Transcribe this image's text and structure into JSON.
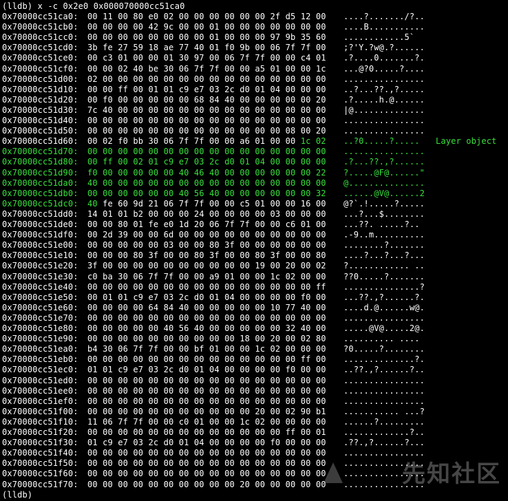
{
  "terminal": {
    "command": "(lldb) x -c 0x2e0 0x000070000cc51ca0",
    "prompt_end": "(lldb)",
    "annotation": "Layer object",
    "highlight_color": "#37e03c",
    "rows": [
      {
        "addr": "0x70000cc51ca0:",
        "hex": "00 11 00 80 e0 02 00 00 00 00 00 00 2f d5 12 00",
        "ascii": "....?......./?..",
        "hl": "none"
      },
      {
        "addr": "0x70000cc51cb0:",
        "hex": "00 00 00 00 42 9c 00 00 01 00 00 00 00 00 00 00",
        "ascii": "....B...........",
        "hl": "none"
      },
      {
        "addr": "0x70000cc51cc0:",
        "hex": "00 00 00 00 00 00 00 00 01 00 00 00 97 9b 35 60",
        "ascii": "............5`",
        "hl": "none"
      },
      {
        "addr": "0x70000cc51cd0:",
        "hex": "3b fe 27 59 18 ae 77 40 01 f0 9b 00 06 7f 7f 00",
        "ascii": ";?'Y.?w@.?......",
        "hl": "none"
      },
      {
        "addr": "0x70000cc51ce0:",
        "hex": "00 c3 01 00 00 01 30 97 00 06 7f 7f 00 00 c4 01",
        "ascii": ".?....0.......?.",
        "hl": "none"
      },
      {
        "addr": "0x70000cc51cf0:",
        "hex": "00 00 02 40 be 30 06 7f 7f 00 00 a5 01 00 00 1c",
        "ascii": "...@?0.....?....",
        "hl": "none"
      },
      {
        "addr": "0x70000cc51d00:",
        "hex": "02 00 00 00 00 00 00 00 00 00 00 00 00 00 00 00",
        "ascii": "................",
        "hl": "none"
      },
      {
        "addr": "0x70000cc51d10:",
        "hex": "00 00 ff 00 01 01 c9 e7 03 2c d0 01 04 00 00 00",
        "ascii": "..?...??.,?.....",
        "hl": "none"
      },
      {
        "addr": "0x70000cc51d20:",
        "hex": "00 f0 00 00 00 00 00 68 84 40 00 00 00 00 00 20",
        "ascii": ".?.....h.@......",
        "hl": "none"
      },
      {
        "addr": "0x70000cc51d30:",
        "hex": "7c 40 00 00 00 00 00 00 00 00 00 00 00 00 00 00",
        "ascii": "|@..............",
        "hl": "none"
      },
      {
        "addr": "0x70000cc51d40:",
        "hex": "00 00 00 00 00 00 00 00 00 00 00 00 00 00 00 00",
        "ascii": "................",
        "hl": "none"
      },
      {
        "addr": "0x70000cc51d50:",
        "hex": "00 00 00 00 00 00 00 00 00 00 00 00 00 08 00 20",
        "ascii": "................",
        "hl": "none"
      },
      {
        "addr": "0x70000cc51d60:",
        "hex": "00 02 f0 bb 30 06 7f 7f 00 00 a6 01 00 00 1c 02",
        "ascii": "..?0.....?.....",
        "hl": "tail2"
      },
      {
        "addr": "0x70000cc51d70:",
        "hex": "00 00 00 00 00 00 00 00 00 00 00 00 00 00 00 00",
        "ascii": "................",
        "hl": "full"
      },
      {
        "addr": "0x70000cc51d80:",
        "hex": "00 ff 00 02 01 c9 e7 03 2c d0 01 04 00 00 00 00",
        "ascii": ".?...??.,?......",
        "hl": "full"
      },
      {
        "addr": "0x70000cc51d90:",
        "hex": "f0 00 00 00 00 00 40 46 40 00 00 00 00 00 00 22",
        "ascii": "?.....@F@......\"",
        "hl": "full"
      },
      {
        "addr": "0x70000cc51da0:",
        "hex": "40 00 00 00 00 00 00 00 00 00 00 00 00 00 00 00",
        "ascii": "@...............",
        "hl": "full"
      },
      {
        "addr": "0x70000cc51db0:",
        "hex": "00 00 00 00 00 00 40 56 40 00 00 00 00 00 00 32",
        "ascii": "......@V@......2",
        "hl": "full"
      },
      {
        "addr": "0x70000cc51dc0:",
        "hex": "40 fe 60 9d 21 06 7f 7f 00 00 c5 01 00 00 16 00",
        "ascii": "@?`.!.....?.....",
        "hl": "first"
      },
      {
        "addr": "0x70000cc51dd0:",
        "hex": "14 01 01 b2 00 00 00 24 00 00 00 00 03 00 00 00",
        "ascii": "...?...$........",
        "hl": "none"
      },
      {
        "addr": "0x70000cc51de0:",
        "hex": "00 00 80 01 fe e0 1d 20 06 7f 7f 00 00 c6 01 00",
        "ascii": "...??. .....?..",
        "hl": "none"
      },
      {
        "addr": "0x70000cc51df0:",
        "hex": "00 2d 39 00 00 6d 00 00 00 00 00 00 00 00 00 00",
        "ascii": ".-9..m..........",
        "hl": "none"
      },
      {
        "addr": "0x70000cc51e00:",
        "hex": "00 00 00 00 00 03 00 00 80 3f 00 00 00 00 00 00",
        "ascii": "........?.......",
        "hl": "none"
      },
      {
        "addr": "0x70000cc51e10:",
        "hex": "00 00 00 80 3f 00 00 80 3f 00 00 80 3f 00 00 80",
        "ascii": "....?...?...?...",
        "hl": "none"
      },
      {
        "addr": "0x70000cc51e20:",
        "hex": "3f 00 00 00 00 00 00 00 00 00 00 19 00 20 00 02",
        "ascii": "?............ ..",
        "hl": "none"
      },
      {
        "addr": "0x70000cc51e30:",
        "hex": "c0 ba 30 06 7f 7f 00 00 a9 01 00 00 1c 02 00 00",
        "ascii": "??0.....?.......",
        "hl": "none"
      },
      {
        "addr": "0x70000cc51e40:",
        "hex": "00 00 00 00 00 00 00 00 00 00 00 00 00 00 00 ff",
        "ascii": "...............?",
        "hl": "none"
      },
      {
        "addr": "0x70000cc51e50:",
        "hex": "00 01 01 c9 e7 03 2c d0 01 04 00 00 00 00 f0 00",
        "ascii": "...??.,?......?.",
        "hl": "none"
      },
      {
        "addr": "0x70000cc51e60:",
        "hex": "00 00 00 00 64 84 40 00 00 00 00 00 10 77 40 00",
        "ascii": "....d.@......w@.",
        "hl": "none"
      },
      {
        "addr": "0x70000cc51e70:",
        "hex": "00 00 00 00 00 00 00 00 00 00 00 00 00 00 00 00",
        "ascii": "................",
        "hl": "none"
      },
      {
        "addr": "0x70000cc51e80:",
        "hex": "00 00 00 00 00 40 56 40 00 00 00 00 00 32 40 00",
        "ascii": ".....@V@.....2@.",
        "hl": "none"
      },
      {
        "addr": "0x70000cc51e90:",
        "hex": "00 00 00 00 00 00 00 00 00 00 18 00 20 00 02 80",
        "ascii": ".......... ....",
        "hl": "none"
      },
      {
        "addr": "0x70000cc51ea0:",
        "hex": "b4 30 06 7f 7f 00 00 bf 01 00 00 1c 02 00 00 00",
        "ascii": "?0.....?........",
        "hl": "none"
      },
      {
        "addr": "0x70000cc51eb0:",
        "hex": "00 00 00 00 00 00 00 00 00 00 00 00 00 00 ff 00",
        "ascii": "..............?.",
        "hl": "none"
      },
      {
        "addr": "0x70000cc51ec0:",
        "hex": "01 01 c9 e7 03 2c d0 01 04 00 00 00 00 f0 00 00",
        "ascii": "..??.,?......?..",
        "hl": "none"
      },
      {
        "addr": "0x70000cc51ed0:",
        "hex": "00 00 00 00 00 00 00 00 00 00 00 00 00 00 00 00",
        "ascii": "................",
        "hl": "none"
      },
      {
        "addr": "0x70000cc51ee0:",
        "hex": "00 00 00 00 00 00 00 00 00 00 00 00 00 00 00 00",
        "ascii": "................",
        "hl": "none"
      },
      {
        "addr": "0x70000cc51ef0:",
        "hex": "00 00 00 00 00 00 00 00 00 00 00 00 00 00 00 00",
        "ascii": "................",
        "hl": "none"
      },
      {
        "addr": "0x70000cc51f00:",
        "hex": "00 00 00 00 00 00 00 00 00 00 00 20 00 02 90 b1",
        "ascii": "........... ...?",
        "hl": "none"
      },
      {
        "addr": "0x70000cc51f10:",
        "hex": "11 06 7f 7f 00 00 c0 01 00 00 1c 02 00 00 00 00",
        "ascii": "......?.........",
        "hl": "none"
      },
      {
        "addr": "0x70000cc51f20:",
        "hex": "00 00 00 00 00 00 00 00 00 00 00 00 00 ff 00 01",
        "ascii": ".............?..",
        "hl": "none"
      },
      {
        "addr": "0x70000cc51f30:",
        "hex": "01 c9 e7 03 2c d0 01 04 00 00 00 00 f0 00 00 00",
        "ascii": ".??.,?......?...",
        "hl": "none"
      },
      {
        "addr": "0x70000cc51f40:",
        "hex": "00 00 00 00 00 00 00 00 00 00 00 00 00 00 00 00",
        "ascii": "................",
        "hl": "none"
      },
      {
        "addr": "0x70000cc51f50:",
        "hex": "00 00 00 00 00 00 00 00 00 00 00 00 00 00 00 00",
        "ascii": "................",
        "hl": "none"
      },
      {
        "addr": "0x70000cc51f60:",
        "hex": "00 00 00 00 00 00 00 00 00 00 00 00 00 00 00 00",
        "ascii": "................",
        "hl": "none"
      },
      {
        "addr": "0x70000cc51f70:",
        "hex": "00 00 00 00 00 00 00 00 00 00 20 00 00 00 00 00",
        "ascii": "................",
        "hl": "none"
      }
    ]
  },
  "watermark": {
    "text": "先知社区",
    "icon": "xianzhi-logo-icon"
  }
}
